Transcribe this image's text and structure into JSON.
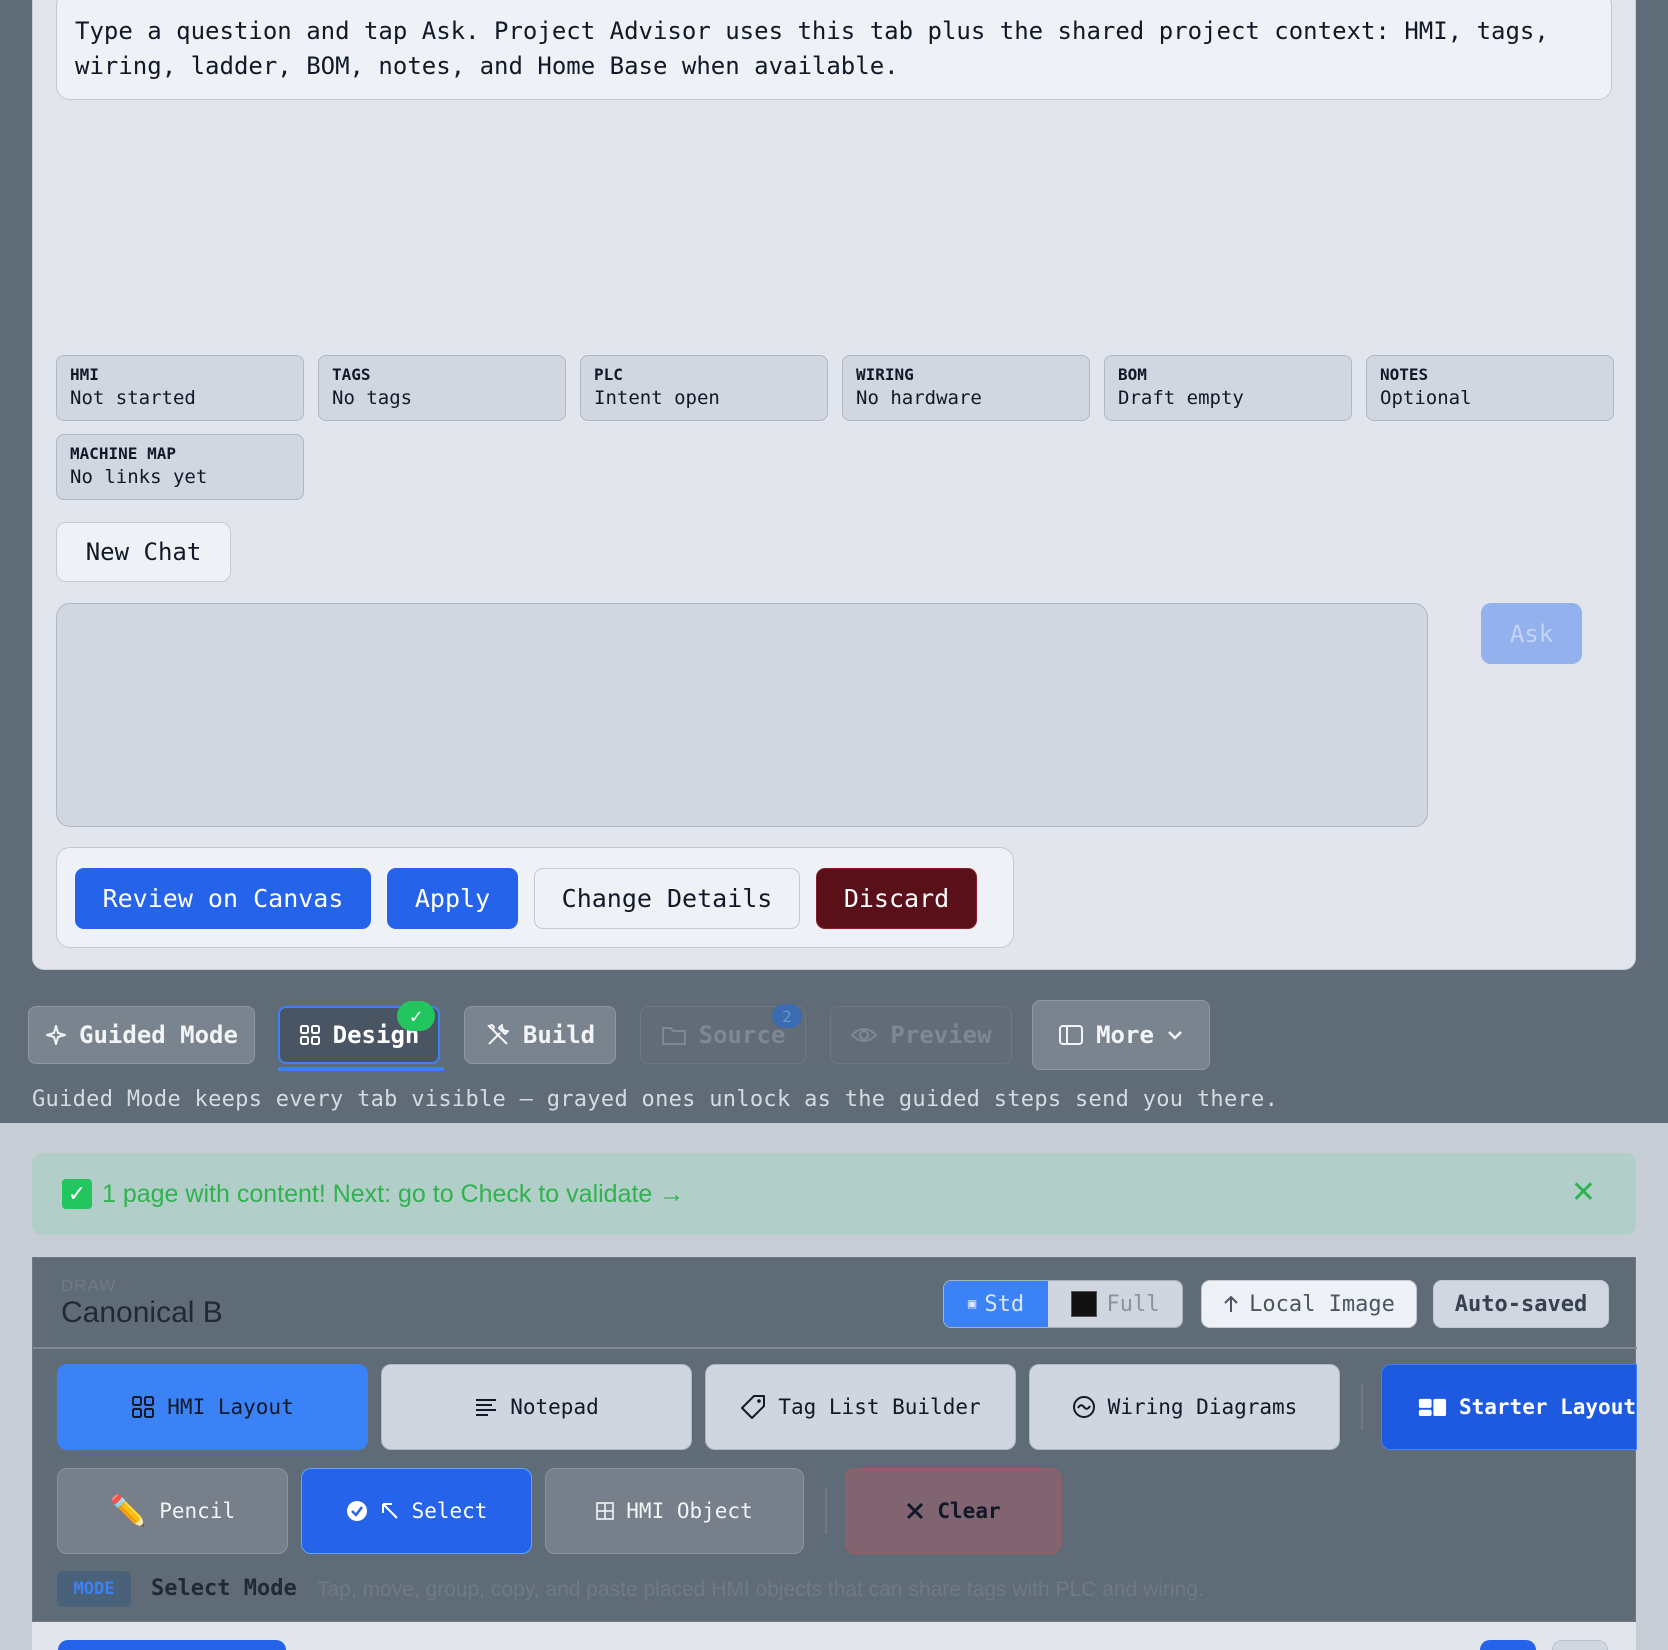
{
  "advisor": {
    "intro": "Type a question and tap Ask. Project Advisor uses this tab plus the shared project context: HMI, tags, wiring, ladder, BOM, notes, and Home Base when available.",
    "chips": [
      {
        "key": "HMI",
        "value": "Not started"
      },
      {
        "key": "TAGS",
        "value": "No tags"
      },
      {
        "key": "PLC",
        "value": "Intent open"
      },
      {
        "key": "WIRING",
        "value": "No hardware"
      },
      {
        "key": "BOM",
        "value": "Draft empty"
      },
      {
        "key": "NOTES",
        "value": "Optional"
      },
      {
        "key": "MACHINE MAP",
        "value": "No links yet"
      }
    ],
    "new_chat": "New Chat",
    "ask_label": "Ask",
    "question_value": "",
    "actions": {
      "review": "Review on Canvas",
      "apply": "Apply",
      "change": "Change Details",
      "discard": "Discard"
    }
  },
  "tabs": [
    {
      "label": "Guided Mode",
      "icon": "sparkle-icon",
      "state": "normal"
    },
    {
      "label": "Design",
      "icon": "grid-icon",
      "state": "active",
      "badge": "✓"
    },
    {
      "label": "Build",
      "icon": "tools-icon",
      "state": "normal"
    },
    {
      "label": "Source",
      "icon": "folder-icon",
      "state": "disabled",
      "badge": "2"
    },
    {
      "label": "Preview",
      "icon": "eye-icon",
      "state": "disabled"
    },
    {
      "label": "More",
      "icon": "panel-icon",
      "state": "normal"
    }
  ],
  "tabs_hint": "Guided Mode keeps every tab visible — grayed ones unlock as the guided steps send you there.",
  "banner": {
    "text": "1 page with content! Next: go to Check to validate →",
    "ok_glyph": "✓",
    "close_glyph": "✕"
  },
  "draw": {
    "section_label": "DRAW",
    "title": "Canonical B",
    "std_label": "Std",
    "full_label": "Full",
    "local_image": "Local Image",
    "autosaved": "Auto-saved",
    "tools_row1": [
      {
        "label": "HMI Layout",
        "icon": "layout-grid-icon"
      },
      {
        "label": "Notepad",
        "icon": "lines-icon"
      },
      {
        "label": "Tag List Builder",
        "icon": "tag-icon"
      },
      {
        "label": "Wiring Diagrams",
        "icon": "wave-circle-icon"
      },
      {
        "label": "Starter Layout",
        "icon": "starter-layout-icon"
      }
    ],
    "tools_row2": [
      {
        "label": "Pencil",
        "icon": "pencil-icon"
      },
      {
        "label": "Select",
        "icon": "cursor-icon"
      },
      {
        "label": "HMI Object",
        "icon": "grid-small-icon"
      },
      {
        "label": "Clear",
        "icon": "close-icon"
      }
    ],
    "mode_badge": "MODE",
    "mode_name": "Select Mode",
    "mode_desc": "Tap, move, group, copy, and paste placed HMI objects that can share tags with PLC and wiring."
  },
  "colors": {
    "accent": "#2563eb",
    "success": "#22c55e",
    "danger": "#5a1018",
    "background": "#5f6b76"
  }
}
